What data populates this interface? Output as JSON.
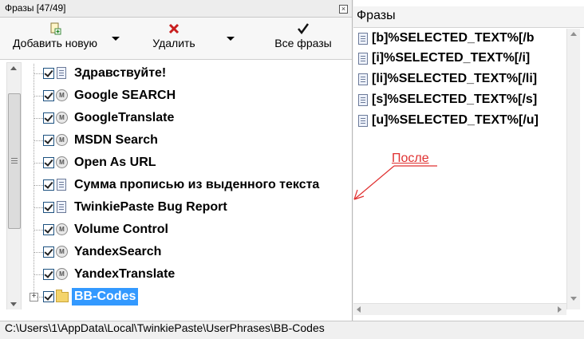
{
  "left_panel": {
    "title": "Фразы [47/49]",
    "close_glyph": "×",
    "toolbar": {
      "add_label": "Добавить новую",
      "delete_label": "Удалить",
      "all_phrases_label": "Все фразы"
    },
    "tree_items": [
      {
        "label": "Здравствуйте!",
        "icon": "document-icon"
      },
      {
        "label": "Google SEARCH",
        "icon": "macro-icon"
      },
      {
        "label": "GoogleTranslate",
        "icon": "macro-icon"
      },
      {
        "label": "MSDN Search",
        "icon": "macro-icon"
      },
      {
        "label": "Open As URL",
        "icon": "macro-icon"
      },
      {
        "label": "Сумма прописью из выденного текста",
        "icon": "document-icon"
      },
      {
        "label": "TwinkiePaste Bug Report",
        "icon": "document-icon"
      },
      {
        "label": "Volume Control",
        "icon": "macro-icon"
      },
      {
        "label": "YandexSearch",
        "icon": "macro-icon"
      },
      {
        "label": "YandexTranslate",
        "icon": "macro-icon"
      },
      {
        "label": "BB-Codes",
        "icon": "folder-icon",
        "selected": true
      }
    ]
  },
  "right_panel": {
    "title": "Фразы",
    "phrases": [
      "[b]%SELECTED_TEXT%[/b",
      "[i]%SELECTED_TEXT%[/i]",
      "[li]%SELECTED_TEXT%[/li]",
      "[s]%SELECTED_TEXT%[/s]",
      "[u]%SELECTED_TEXT%[/u]"
    ]
  },
  "annotation": {
    "text": "После",
    "color": "#e03030"
  },
  "status_bar": {
    "path": "C:\\Users\\1\\AppData\\Local\\TwinkiePaste\\UserPhrases\\BB-Codes"
  },
  "colors": {
    "selection": "#3399ff"
  }
}
